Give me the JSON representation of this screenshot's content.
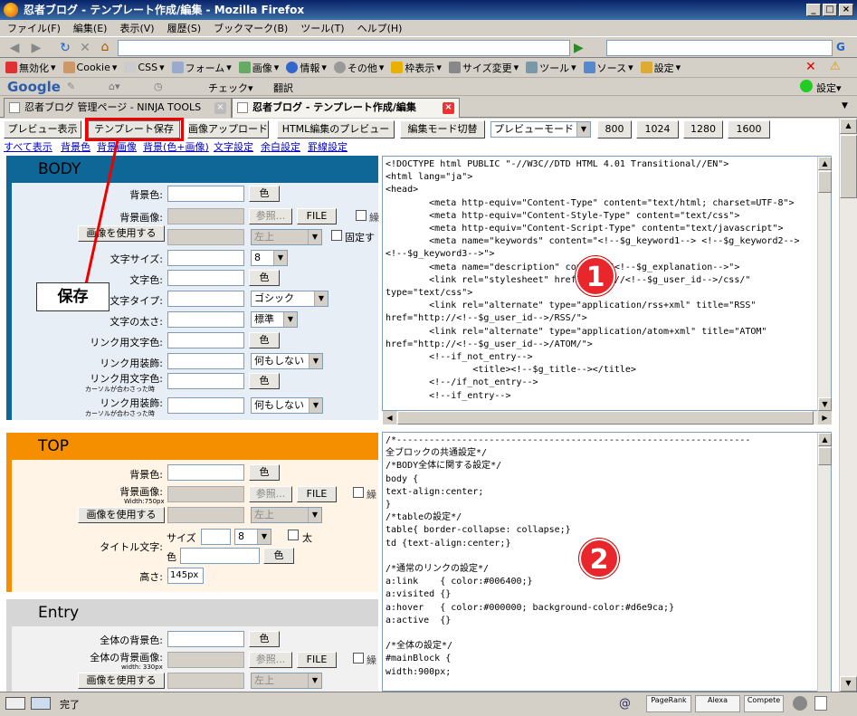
{
  "window": {
    "title": "忍者ブログ - テンプレート作成/編集 - Mozilla Firefox"
  },
  "menu": [
    "ファイル(F)",
    "編集(E)",
    "表示(V)",
    "履歴(S)",
    "ブックマーク(B)",
    "ツール(T)",
    "ヘルプ(H)"
  ],
  "devbar": [
    "無効化",
    "Cookie",
    "CSS",
    "フォーム",
    "画像",
    "情報",
    "その他",
    "枠表示",
    "サイズ変更",
    "ツール",
    "ソース",
    "設定"
  ],
  "googlebar": {
    "logo": "Google",
    "check": "チェック",
    "translate": "翻訳",
    "settings": "設定"
  },
  "tabs": [
    {
      "label": "忍者ブログ 管理ページ - NINJA TOOLS"
    },
    {
      "label": "忍者ブログ - テンプレート作成/編集"
    }
  ],
  "toolbar": {
    "preview": "プレビュー表示",
    "save": "テンプレート保存",
    "upload": "画像アップロード",
    "html_preview": "HTML編集のプレビュー",
    "mode_switch": "編集モード切替",
    "preview_mode": "プレビューモード",
    "w800": "800",
    "w1024": "1024",
    "w1280": "1280",
    "w1600": "1600"
  },
  "links": [
    "すべて表示",
    "背景色",
    "背景画像",
    "背景(色+画像)",
    "文字設定",
    "余白設定",
    "罫線設定"
  ],
  "annotation": {
    "save_label": "保存"
  },
  "body_section": {
    "title": "BODY",
    "bg_color": "背景色:",
    "bg_image": "背景画像:",
    "use_image": "画像を使用する",
    "font_size": "文字サイズ:",
    "font_color": "文字色:",
    "font_type": "文字タイプ:",
    "font_weight": "文字の太さ:",
    "link_color": "リンク用文字色:",
    "link_decor": "リンク用装飾:",
    "link_hover_color": "リンク用文字色:",
    "hover_note": "カーソルが合わさった時",
    "link_hover_decor": "リンク用装飾:",
    "hover_note2": "カーソルが合わさった時",
    "color_btn": "色",
    "browse_btn": "参照...",
    "file_btn": "FILE",
    "repeat_cb": "繰",
    "position_sel": "左上",
    "fixed_cb": "固定す",
    "size_sel": "8",
    "type_sel": "ゴシック",
    "weight_sel": "標準",
    "decor_sel": "何もしない",
    "decor_sel2": "何もしない"
  },
  "top_section": {
    "title": "TOP",
    "bg_color": "背景色:",
    "bg_image": "背景画像:",
    "width_note": "Width:750px",
    "use_image": "画像を使用する",
    "title_text": "タイトル文字:",
    "size_label": "サイズ",
    "color_label": "色",
    "size_sel": "8",
    "bold_cb": "太",
    "height": "高さ:",
    "height_value": "145px",
    "color_btn": "色",
    "browse_btn": "参照...",
    "file_btn": "FILE",
    "repeat_cb": "繰",
    "position_sel": "左上"
  },
  "entry_section": {
    "title": "Entry",
    "bg_color": "全体の背景色:",
    "bg_image": "全体の背景画像:",
    "width_note": "width: 330px",
    "use_image": "画像を使用する",
    "color_btn": "色",
    "browse_btn": "参照...",
    "file_btn": "FILE",
    "repeat_cb": "繰",
    "position_sel": "左上"
  },
  "html_code": "<!DOCTYPE html PUBLIC \"-//W3C//DTD HTML 4.01 Transitional//EN\">\n<html lang=\"ja\">\n<head>\n        <meta http-equiv=\"Content-Type\" content=\"text/html; charset=UTF-8\">\n        <meta http-equiv=\"Content-Style-Type\" content=\"text/css\">\n        <meta http-equiv=\"Content-Script-Type\" content=\"text/javascript\">\n        <meta name=\"keywords\" content=\"<!--$g_keyword1--> <!--$g_keyword2-->\n<!--$g_keyword3-->\">\n        <meta name=\"description\" content=\"<!--$g_explanation-->\">\n        <link rel=\"stylesheet\" href=\"http://<!--$g_user_id-->/css/\"\ntype=\"text/css\">\n        <link rel=\"alternate\" type=\"application/rss+xml\" title=\"RSS\"\nhref=\"http://<!--$g_user_id-->/RSS/\">\n        <link rel=\"alternate\" type=\"application/atom+xml\" title=\"ATOM\"\nhref=\"http://<!--$g_user_id-->/ATOM/\">\n        <!--if_not_entry-->\n                <title><!--$g_title--></title>\n        <!--/if_not_entry-->\n        <!--if_entry-->",
  "css_code": "/*-----------------------------------------------------------------\n全ブロックの共通設定*/\n/*BODY全体に関する設定*/\nbody {\ntext-align:center;\n}\n/*tableの設定*/\ntable{ border-collapse: collapse;}\ntd {text-align:center;}\n\n/*通常のリンクの設定*/\na:link    { color:#006400;}\na:visited {}\na:hover   { color:#000000; background-color:#d6e9ca;}\na:active  {}\n\n/*全体の設定*/\n#mainBlock {\nwidth:900px;",
  "badges": [
    "1",
    "2"
  ],
  "status": {
    "text": "完了",
    "pagerank": "PageRank",
    "alexa": "Alexa",
    "compete": "Compete"
  },
  "colors": {
    "body_bar": "#0e6796",
    "top_bar": "#f68f00",
    "entry_bar": "#d6d6d6",
    "accent_red": "#e8262b"
  }
}
